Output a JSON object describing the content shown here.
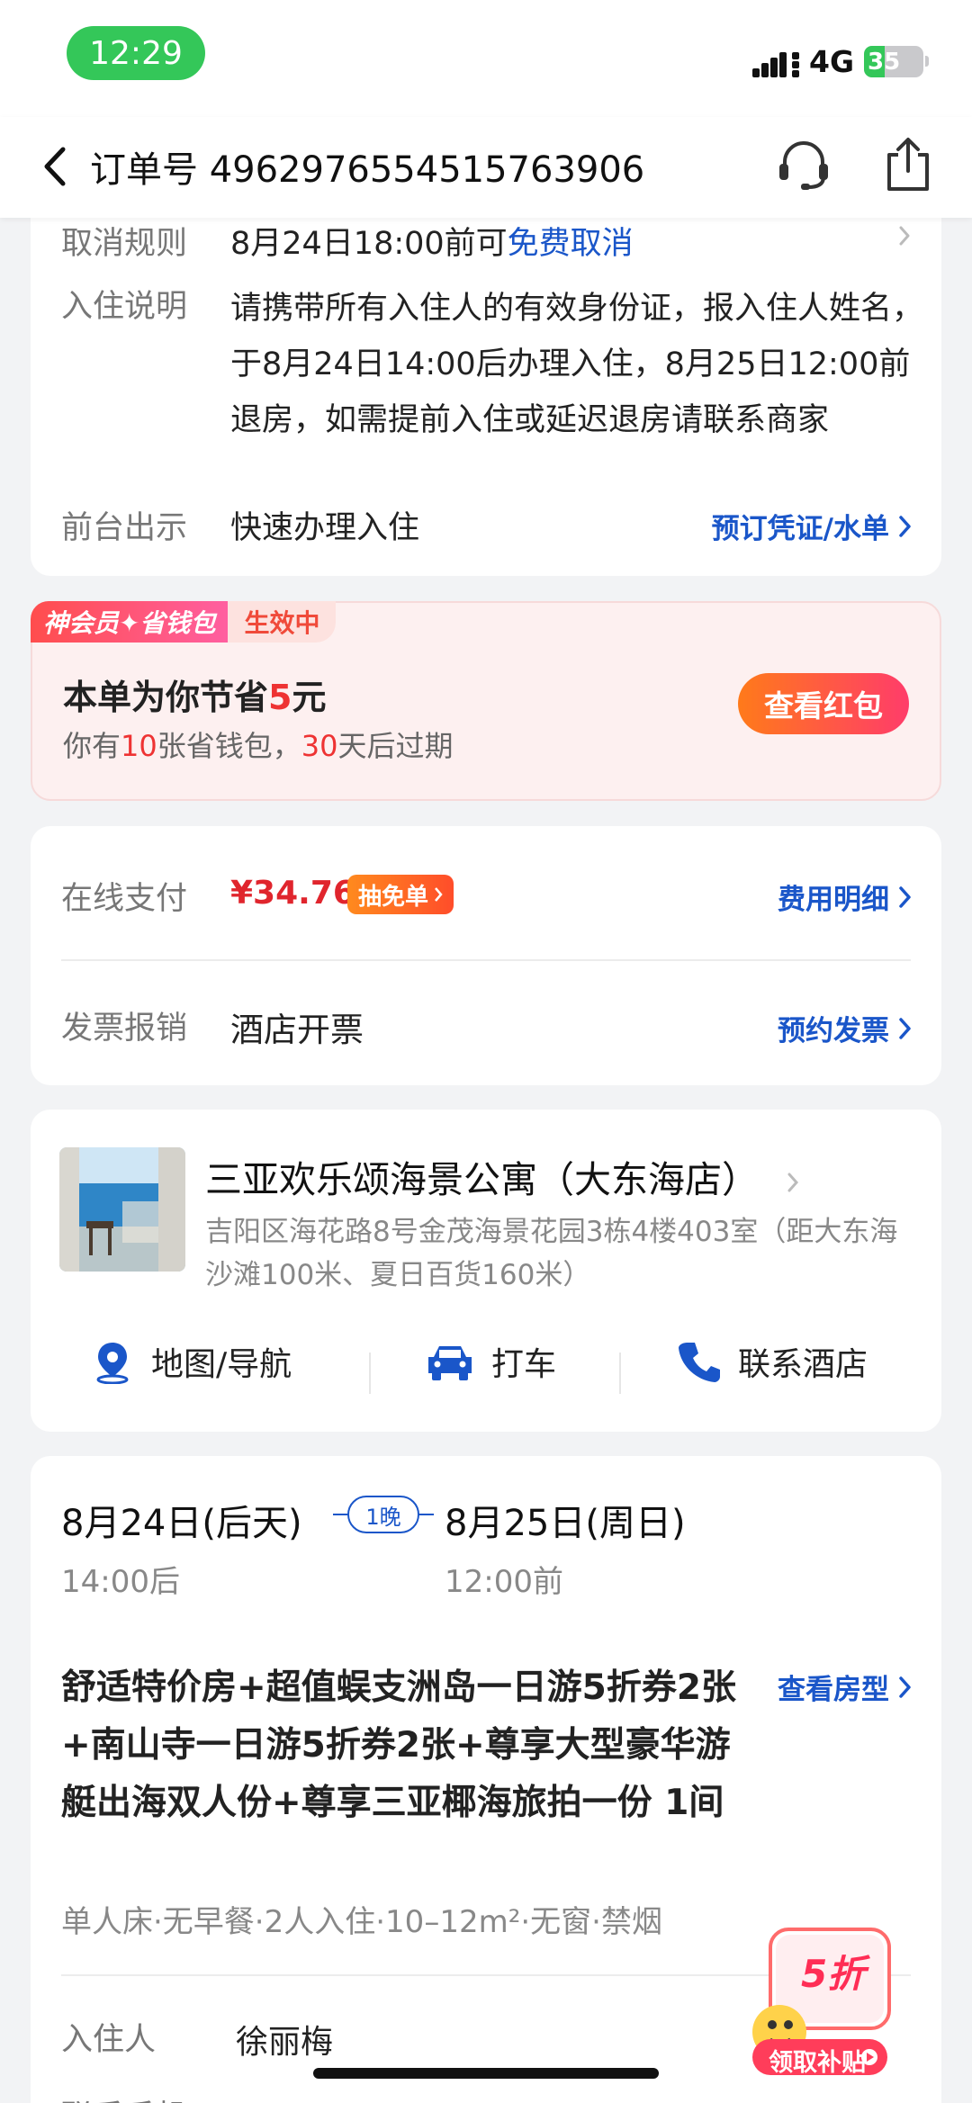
{
  "status_bar": {
    "time": "12:29",
    "network": "4G",
    "battery_text": "35",
    "battery_level": 0.35,
    "time_pill_color": "#34c759"
  },
  "nav": {
    "title": "订单号 4962976554515763906",
    "icons": [
      "back-icon",
      "headset-icon",
      "share-icon"
    ]
  },
  "policy": {
    "cancel_label": "取消规则",
    "cancel_text": "8月24日18:00前可",
    "cancel_link": "免费取消",
    "checkin_label": "入住说明",
    "checkin_text": "请携带所有入住人的有效身份证，报入住人姓名，于8月24日14:00后办理入住，8月25日12:00前退房，如需提前入住或延迟退房请联系商家",
    "frontdesk_label": "前台出示",
    "frontdesk_text": "快速办理入住",
    "voucher_link": "预订凭证/水单"
  },
  "member": {
    "badge": "神会员✦省钱包",
    "status": "生效中",
    "title_prefix": "本单为你节省",
    "saved_amount": "5",
    "title_suffix": "元",
    "sub_prefix": "你有",
    "wallet_count": "10",
    "sub_mid": "张省钱包，",
    "expire_days": "30",
    "sub_suffix": "天后过期",
    "button": "查看红包"
  },
  "payment": {
    "label": "在线支付",
    "price": "¥34.76",
    "tag": "抽免单",
    "detail_link": "费用明细",
    "invoice_label": "发票报销",
    "invoice_value": "酒店开票",
    "invoice_link": "预约发票"
  },
  "hotel": {
    "name": "三亚欢乐颂海景公寓（大东海店）",
    "address": "吉阳区海花路8号金茂海景花园3栋4楼403室（距大东海沙滩100米、夏日百货160米）",
    "actions": [
      {
        "label": "地图/导航",
        "icon": "map-pin-icon"
      },
      {
        "label": "打车",
        "icon": "car-icon"
      },
      {
        "label": "联系酒店",
        "icon": "phone-icon"
      }
    ]
  },
  "stay": {
    "checkin_date": "8月24日(后天)",
    "checkin_time": "14:00后",
    "nights": "1晚",
    "checkout_date": "8月25日(周日)",
    "checkout_time": "12:00前",
    "room_title": "舒适特价房+超值蜈支洲岛一日游5折券2张+南山寺一日游5折券2张+尊享大型豪华游艇出海双人份+尊享三亚椰海旅拍一份 1间",
    "room_link": "查看房型",
    "room_specs": "单人床·无早餐·2人入住·10–12m²·无窗·禁烟",
    "guest_label": "入住人",
    "guest_name": "徐丽梅",
    "phone_label": "联系手机"
  },
  "coupon": {
    "discount": "5折",
    "cta": "领取补贴"
  },
  "colors": {
    "accent_blue": "#1a56c9",
    "price_red": "#e0252d",
    "member_bg": "#fdf0f0"
  }
}
